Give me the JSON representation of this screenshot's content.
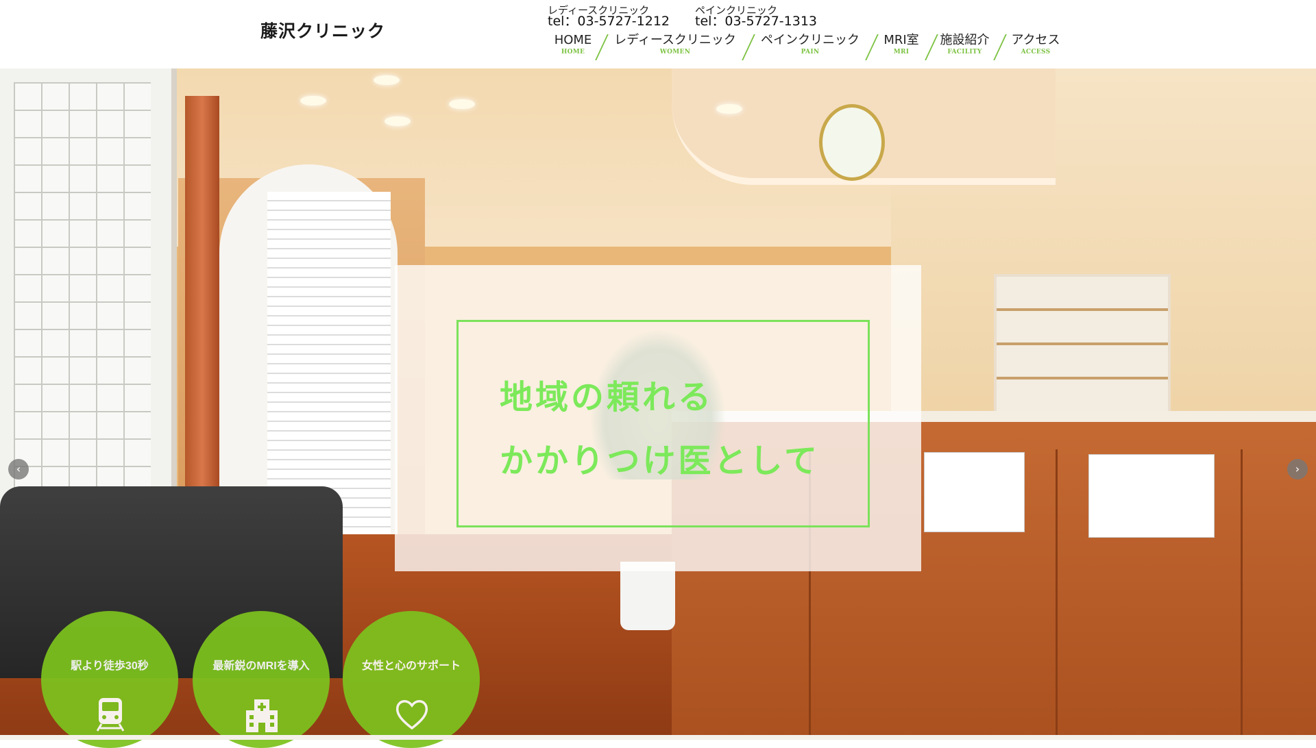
{
  "header": {
    "logo": "藤沢クリニック",
    "tel_ladies": {
      "name": "レディースクリニック",
      "number": "tel：03-5727-1212"
    },
    "tel_pain": {
      "name": "ペインクリニック",
      "number": "tel：03-5727-1313"
    },
    "nav": [
      {
        "jp": "HOME",
        "en": "HOME"
      },
      {
        "jp": "レディースクリニック",
        "en": "WOMEN"
      },
      {
        "jp": "ペインクリニック",
        "en": "PAIN"
      },
      {
        "jp": "MRI室",
        "en": "MRI"
      },
      {
        "jp": "施設紹介",
        "en": "FACILITY"
      },
      {
        "jp": "アクセス",
        "en": "ACCESS"
      }
    ]
  },
  "hero": {
    "tagline_1": "地域の頼れる",
    "tagline_2": "かかりつけ医として",
    "prev_arrow": "‹",
    "next_arrow": "›"
  },
  "features": [
    {
      "label": "駅より徒歩30秒",
      "icon": "train-icon"
    },
    {
      "label": "最新鋭のMRIを導入",
      "icon": "hospital-icon"
    },
    {
      "label": "女性と心のサポート",
      "icon": "heart-icon"
    }
  ],
  "colors": {
    "accent_green": "#7cc242",
    "tagline_green": "#7ce95a",
    "feature_green": "#7dc21e"
  }
}
